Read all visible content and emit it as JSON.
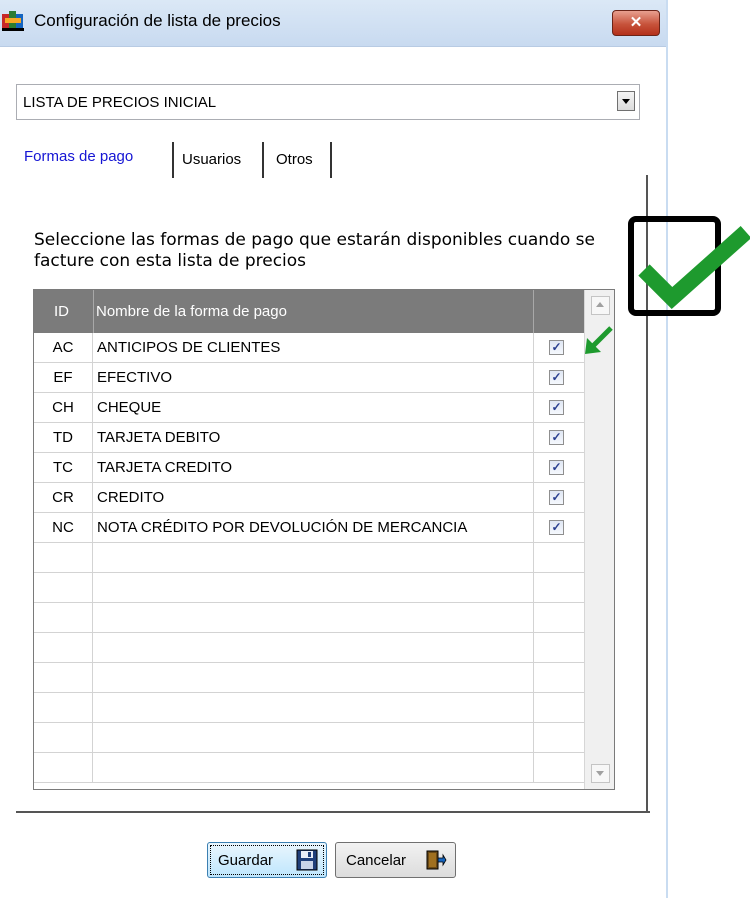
{
  "window": {
    "title": "Configuración de lista de precios",
    "close_label": "✕"
  },
  "price_list_select": {
    "value": "LISTA DE PRECIOS INICIAL"
  },
  "tabs": [
    {
      "label": "Formas de pago",
      "active": true
    },
    {
      "label": "Usuarios",
      "active": false
    },
    {
      "label": "Otros",
      "active": false
    }
  ],
  "instructions": "Seleccione las formas de pago que estarán disponibles cuando se facture con esta lista de precios",
  "grid": {
    "columns": {
      "id": "ID",
      "name": "Nombre de la forma de pago"
    },
    "rows": [
      {
        "id": "AC",
        "name": "ANTICIPOS DE CLIENTES",
        "checked": true
      },
      {
        "id": "EF",
        "name": "EFECTIVO",
        "checked": true
      },
      {
        "id": "CH",
        "name": "CHEQUE",
        "checked": true
      },
      {
        "id": "TD",
        "name": "TARJETA DEBITO",
        "checked": true
      },
      {
        "id": "TC",
        "name": "TARJETA CREDITO",
        "checked": true
      },
      {
        "id": "CR",
        "name": "CREDITO",
        "checked": true
      },
      {
        "id": "NC",
        "name": "NOTA CRÉDITO POR DEVOLUCIÓN DE MERCANCIA",
        "checked": true
      }
    ],
    "empty_rows": 8
  },
  "buttons": {
    "save_label": "Guardar",
    "cancel_label": "Cancelar"
  },
  "icons": {
    "app": "app-icon",
    "save": "floppy-disk-icon",
    "cancel": "exit-door-icon",
    "annotation": "green-checkmark-icon",
    "arrow": "green-arrow-icon"
  },
  "colors": {
    "active_tab": "#1515d4",
    "grid_header": "#7b7b7b",
    "annotation_green": "#1e9a2e"
  }
}
